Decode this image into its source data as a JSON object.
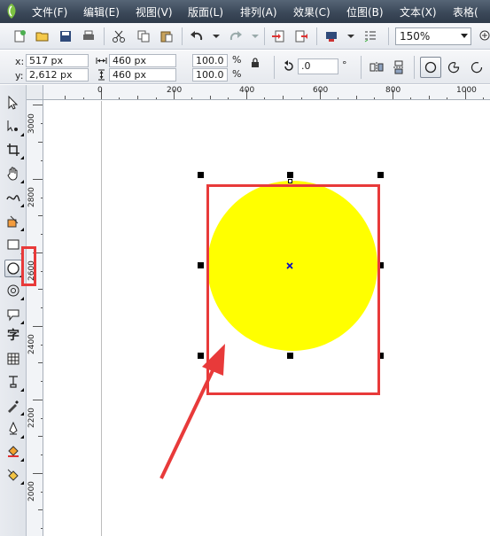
{
  "menu": {
    "items": [
      "文件(F)",
      "编辑(E)",
      "视图(V)",
      "版面(L)",
      "排列(A)",
      "效果(C)",
      "位图(B)",
      "文本(X)",
      "表格("
    ]
  },
  "toolbar": {
    "zoom_value": "150%",
    "icons": [
      "new-document",
      "open",
      "save",
      "print",
      "cut",
      "copy",
      "paste",
      "undo",
      "redo",
      "import",
      "export",
      "application-launcher",
      "options"
    ]
  },
  "properties": {
    "x_label": "x:",
    "x_value": "517 px",
    "y_label": "y:",
    "y_value": "2,612 px",
    "width_value": "460 px",
    "height_value": "460 px",
    "scale_x": "100.0",
    "scale_y": "100.0",
    "percent": "%",
    "rotation_value": ".0",
    "degree_symbol": "°"
  },
  "ruler": {
    "h_labels": [
      "0",
      "200",
      "400",
      "600",
      "800",
      "1000"
    ],
    "v_labels": [
      "3000",
      "2800",
      "2600",
      "2400",
      "2200",
      "2000"
    ]
  },
  "tools": [
    "pick-tool",
    "shape-tool",
    "crop-tool",
    "pan-tool",
    "freehand-tool",
    "smart-fill-tool",
    "rectangle-tool",
    "ellipse-tool",
    "polygon-tool",
    "basic-shapes-tool",
    "text-tool",
    "table-tool",
    "dimension-tool",
    "eyedropper-tool",
    "outline-tool",
    "fill-tool",
    "interactive-fill-tool"
  ],
  "colors": {
    "circle_fill": "#ffff00",
    "annotation": "#e83a3a",
    "menubar": "#3b4859"
  }
}
